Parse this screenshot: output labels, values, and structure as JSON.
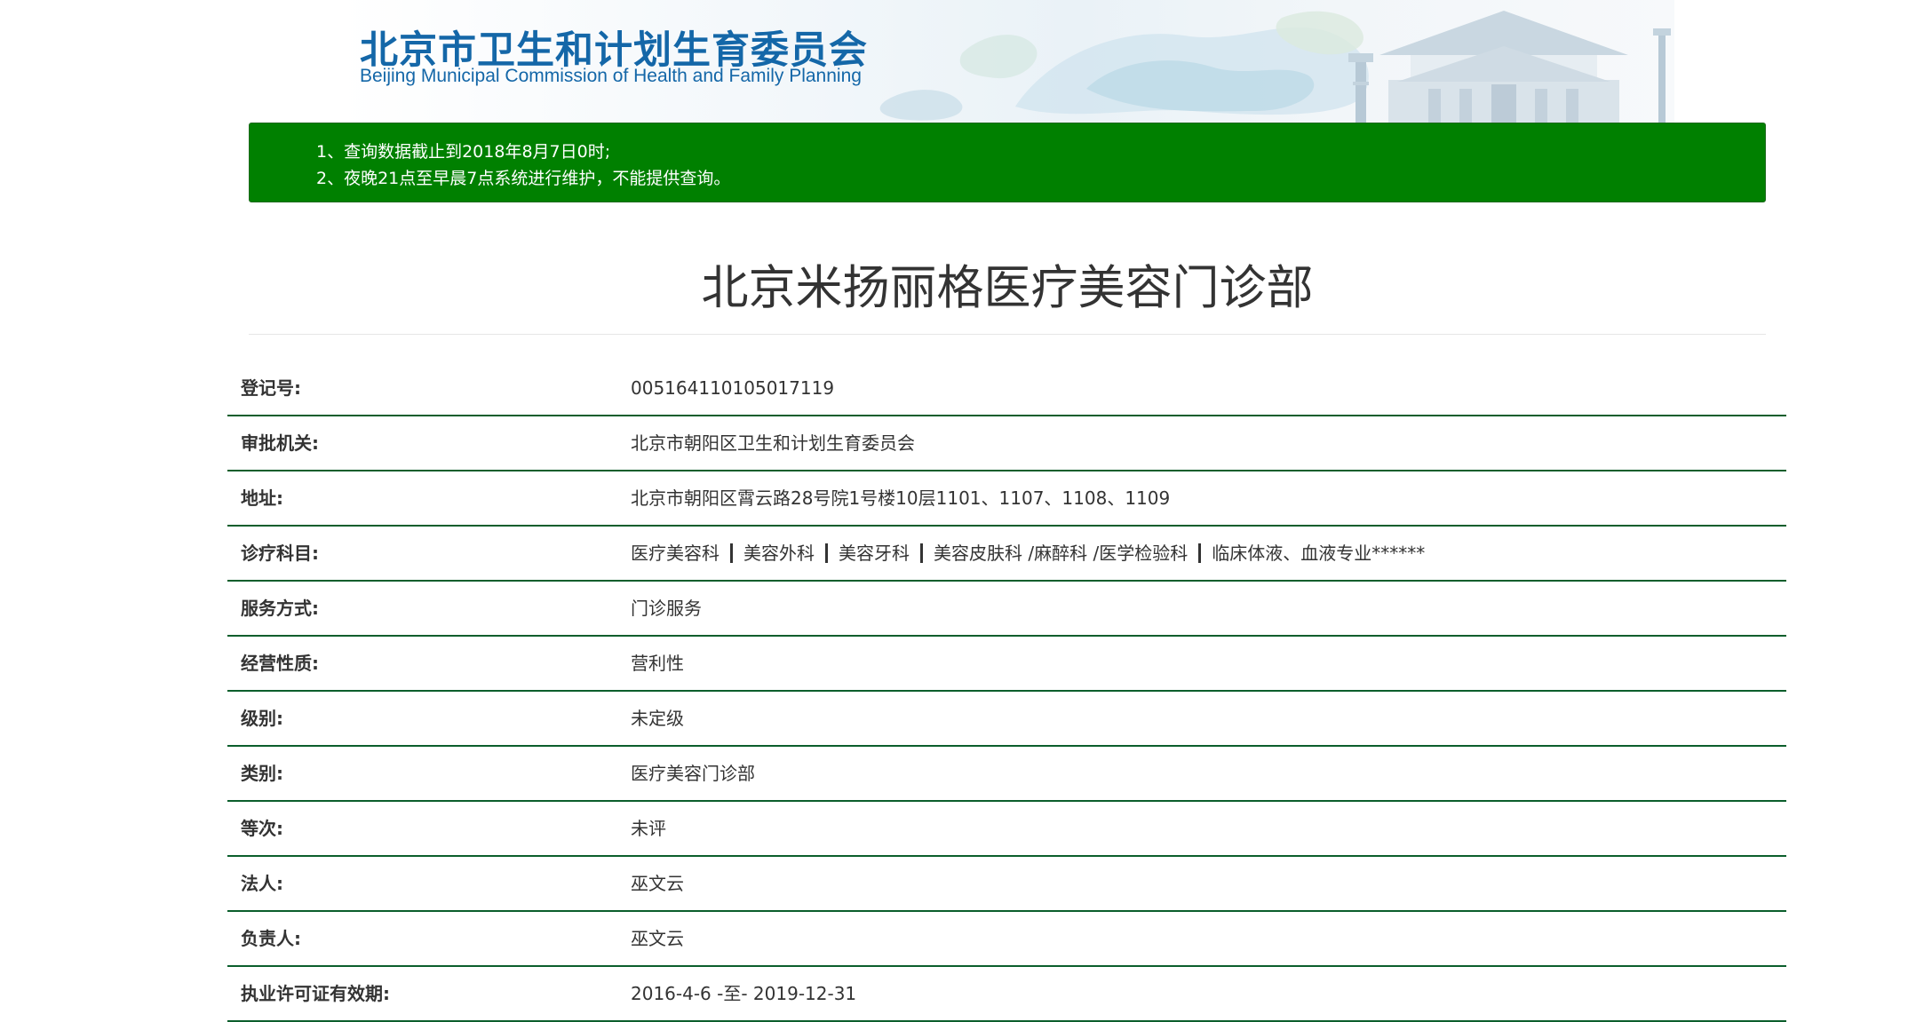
{
  "banner": {
    "title": "北京市卫生和计划生育委员会",
    "subtitle": "Beijing Municipal Commission of Health and Family Planning",
    "colors": {
      "title": "#1467a8"
    }
  },
  "notice": {
    "lines": [
      "1、查询数据截止到2018年8月7日0时;",
      "2、夜晚21点至早晨7点系统进行维护，不能提供查询。"
    ],
    "colors": {
      "background": "#008000",
      "text": "#ffffff"
    }
  },
  "page": {
    "title": "北京米扬丽格医疗美容门诊部"
  },
  "info": {
    "rows": [
      {
        "label": "登记号:",
        "value": "005164110105017119"
      },
      {
        "label": "审批机关:",
        "value": "北京市朝阳区卫生和计划生育委员会"
      },
      {
        "label": "地址:",
        "value": "北京市朝阳区霄云路28号院1号楼10层1101、1107、1108、1109"
      },
      {
        "label": "诊疗科目:",
        "departments": [
          "医疗美容科",
          "美容外科",
          "美容牙科",
          "美容皮肤科 /麻醉科 /医学检验科",
          "临床体液、血液专业******"
        ]
      },
      {
        "label": "服务方式:",
        "value": "门诊服务"
      },
      {
        "label": "经营性质:",
        "value": "营利性"
      },
      {
        "label": "级别:",
        "value": "未定级"
      },
      {
        "label": "类别:",
        "value": "医疗美容门诊部"
      },
      {
        "label": "等次:",
        "value": "未评"
      },
      {
        "label": "法人:",
        "value": "巫文云"
      },
      {
        "label": "负责人:",
        "value": "巫文云"
      },
      {
        "label": "执业许可证有效期:",
        "value": "2016-4-6 -至- 2019-12-31"
      }
    ],
    "colors": {
      "rule": "#0b5e2c"
    }
  }
}
